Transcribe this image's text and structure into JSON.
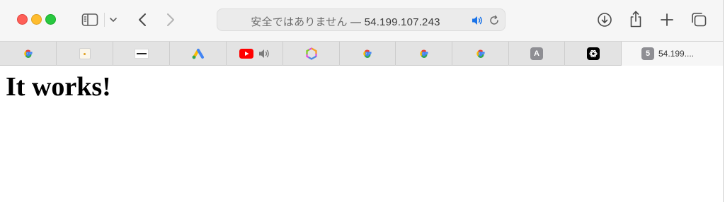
{
  "window": {
    "address_bar": {
      "security_text": "安全ではありません",
      "separator": "—",
      "host": "54.199.107.243"
    }
  },
  "tabs": [
    {
      "icon": "google-icon"
    },
    {
      "icon": "dot-favicon-icon"
    },
    {
      "icon": "site-logo-icon"
    },
    {
      "icon": "google-ads-icon"
    },
    {
      "icon": "youtube-icon",
      "audio": "speaker-icon"
    },
    {
      "icon": "hexagon-logo-icon"
    },
    {
      "icon": "google-icon"
    },
    {
      "icon": "google-icon"
    },
    {
      "icon": "google-icon"
    },
    {
      "icon": "letter-a-icon",
      "letter": "A"
    },
    {
      "icon": "openai-icon"
    },
    {
      "icon": "number-five-icon",
      "letter": "5",
      "title": "54.199...."
    }
  ],
  "page": {
    "heading": "It works!"
  },
  "colors": {
    "traffic_red": "#fe5f57",
    "traffic_yellow": "#febc2e",
    "traffic_green": "#28c840",
    "speaker_blue": "#1a73e8"
  }
}
